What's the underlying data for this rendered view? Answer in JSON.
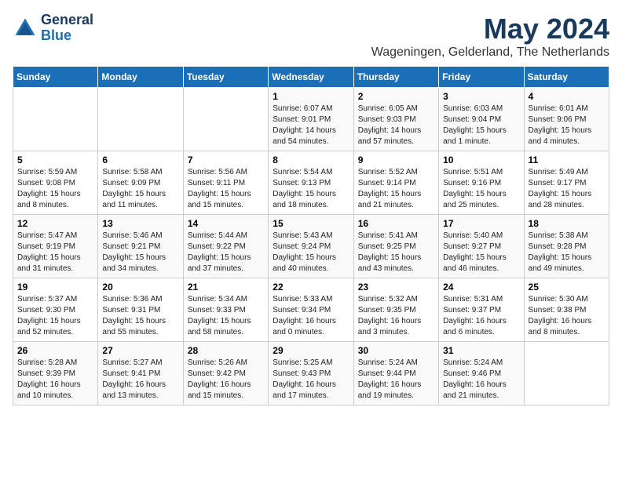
{
  "header": {
    "logo_line1": "General",
    "logo_line2": "Blue",
    "month": "May 2024",
    "location": "Wageningen, Gelderland, The Netherlands"
  },
  "weekdays": [
    "Sunday",
    "Monday",
    "Tuesday",
    "Wednesday",
    "Thursday",
    "Friday",
    "Saturday"
  ],
  "weeks": [
    [
      {
        "day": "",
        "info": ""
      },
      {
        "day": "",
        "info": ""
      },
      {
        "day": "",
        "info": ""
      },
      {
        "day": "1",
        "info": "Sunrise: 6:07 AM\nSunset: 9:01 PM\nDaylight: 14 hours\nand 54 minutes."
      },
      {
        "day": "2",
        "info": "Sunrise: 6:05 AM\nSunset: 9:03 PM\nDaylight: 14 hours\nand 57 minutes."
      },
      {
        "day": "3",
        "info": "Sunrise: 6:03 AM\nSunset: 9:04 PM\nDaylight: 15 hours\nand 1 minute."
      },
      {
        "day": "4",
        "info": "Sunrise: 6:01 AM\nSunset: 9:06 PM\nDaylight: 15 hours\nand 4 minutes."
      }
    ],
    [
      {
        "day": "5",
        "info": "Sunrise: 5:59 AM\nSunset: 9:08 PM\nDaylight: 15 hours\nand 8 minutes."
      },
      {
        "day": "6",
        "info": "Sunrise: 5:58 AM\nSunset: 9:09 PM\nDaylight: 15 hours\nand 11 minutes."
      },
      {
        "day": "7",
        "info": "Sunrise: 5:56 AM\nSunset: 9:11 PM\nDaylight: 15 hours\nand 15 minutes."
      },
      {
        "day": "8",
        "info": "Sunrise: 5:54 AM\nSunset: 9:13 PM\nDaylight: 15 hours\nand 18 minutes."
      },
      {
        "day": "9",
        "info": "Sunrise: 5:52 AM\nSunset: 9:14 PM\nDaylight: 15 hours\nand 21 minutes."
      },
      {
        "day": "10",
        "info": "Sunrise: 5:51 AM\nSunset: 9:16 PM\nDaylight: 15 hours\nand 25 minutes."
      },
      {
        "day": "11",
        "info": "Sunrise: 5:49 AM\nSunset: 9:17 PM\nDaylight: 15 hours\nand 28 minutes."
      }
    ],
    [
      {
        "day": "12",
        "info": "Sunrise: 5:47 AM\nSunset: 9:19 PM\nDaylight: 15 hours\nand 31 minutes."
      },
      {
        "day": "13",
        "info": "Sunrise: 5:46 AM\nSunset: 9:21 PM\nDaylight: 15 hours\nand 34 minutes."
      },
      {
        "day": "14",
        "info": "Sunrise: 5:44 AM\nSunset: 9:22 PM\nDaylight: 15 hours\nand 37 minutes."
      },
      {
        "day": "15",
        "info": "Sunrise: 5:43 AM\nSunset: 9:24 PM\nDaylight: 15 hours\nand 40 minutes."
      },
      {
        "day": "16",
        "info": "Sunrise: 5:41 AM\nSunset: 9:25 PM\nDaylight: 15 hours\nand 43 minutes."
      },
      {
        "day": "17",
        "info": "Sunrise: 5:40 AM\nSunset: 9:27 PM\nDaylight: 15 hours\nand 46 minutes."
      },
      {
        "day": "18",
        "info": "Sunrise: 5:38 AM\nSunset: 9:28 PM\nDaylight: 15 hours\nand 49 minutes."
      }
    ],
    [
      {
        "day": "19",
        "info": "Sunrise: 5:37 AM\nSunset: 9:30 PM\nDaylight: 15 hours\nand 52 minutes."
      },
      {
        "day": "20",
        "info": "Sunrise: 5:36 AM\nSunset: 9:31 PM\nDaylight: 15 hours\nand 55 minutes."
      },
      {
        "day": "21",
        "info": "Sunrise: 5:34 AM\nSunset: 9:33 PM\nDaylight: 15 hours\nand 58 minutes."
      },
      {
        "day": "22",
        "info": "Sunrise: 5:33 AM\nSunset: 9:34 PM\nDaylight: 16 hours\nand 0 minutes."
      },
      {
        "day": "23",
        "info": "Sunrise: 5:32 AM\nSunset: 9:35 PM\nDaylight: 16 hours\nand 3 minutes."
      },
      {
        "day": "24",
        "info": "Sunrise: 5:31 AM\nSunset: 9:37 PM\nDaylight: 16 hours\nand 6 minutes."
      },
      {
        "day": "25",
        "info": "Sunrise: 5:30 AM\nSunset: 9:38 PM\nDaylight: 16 hours\nand 8 minutes."
      }
    ],
    [
      {
        "day": "26",
        "info": "Sunrise: 5:28 AM\nSunset: 9:39 PM\nDaylight: 16 hours\nand 10 minutes."
      },
      {
        "day": "27",
        "info": "Sunrise: 5:27 AM\nSunset: 9:41 PM\nDaylight: 16 hours\nand 13 minutes."
      },
      {
        "day": "28",
        "info": "Sunrise: 5:26 AM\nSunset: 9:42 PM\nDaylight: 16 hours\nand 15 minutes."
      },
      {
        "day": "29",
        "info": "Sunrise: 5:25 AM\nSunset: 9:43 PM\nDaylight: 16 hours\nand 17 minutes."
      },
      {
        "day": "30",
        "info": "Sunrise: 5:24 AM\nSunset: 9:44 PM\nDaylight: 16 hours\nand 19 minutes."
      },
      {
        "day": "31",
        "info": "Sunrise: 5:24 AM\nSunset: 9:46 PM\nDaylight: 16 hours\nand 21 minutes."
      },
      {
        "day": "",
        "info": ""
      }
    ]
  ]
}
